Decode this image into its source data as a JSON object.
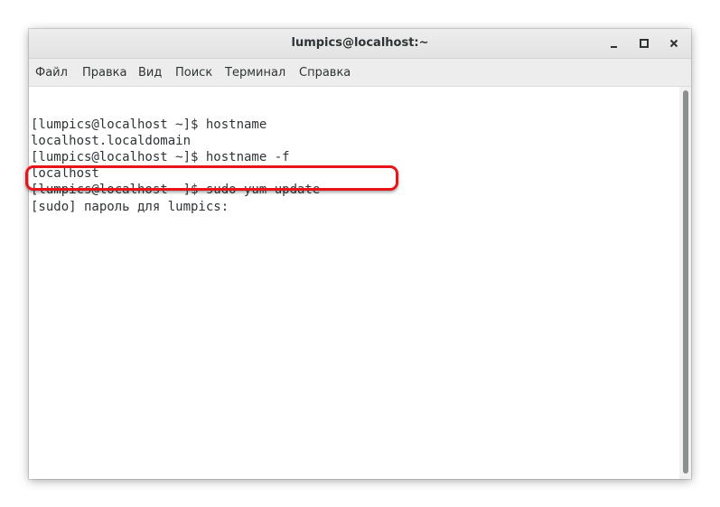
{
  "window": {
    "title": "lumpics@localhost:~"
  },
  "window_controls": {
    "minimize_icon": "minimize-icon",
    "maximize_icon": "maximize-icon",
    "close_icon": "close-icon"
  },
  "menu": {
    "items": [
      "Файл",
      "Правка",
      "Вид",
      "Поиск",
      "Терминал",
      "Справка"
    ]
  },
  "terminal": {
    "lines": [
      "[lumpics@localhost ~]$ hostname",
      "localhost.localdomain",
      "[lumpics@localhost ~]$ hostname -f",
      "localhost",
      "[lumpics@localhost ~]$ sudo yum update",
      "[sudo] пароль для lumpics:"
    ]
  },
  "colors": {
    "highlight": "#e8141a",
    "text": "#2e3436",
    "titlebar": "#ebebeb"
  }
}
